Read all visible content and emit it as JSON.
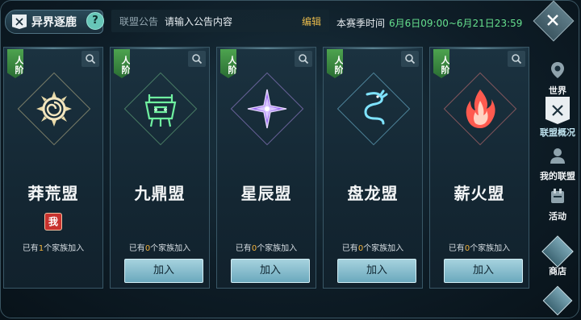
{
  "header": {
    "title": "异界逐鹿",
    "help_label": "?",
    "notice_label": "联盟公告",
    "notice_placeholder": "请输入公告内容",
    "edit_label": "编辑",
    "season_label": "本赛季时间",
    "season_time": "6月6日09:00~6月21日23:59"
  },
  "alliances": [
    {
      "rank": "人阶",
      "name": "莽荒盟",
      "count_prefix": "已有",
      "count": "1",
      "count_suffix": "个家族加入",
      "me": "我",
      "emblem": "sun-vortex-emblem",
      "color": "#e8d9a8"
    },
    {
      "rank": "人阶",
      "name": "九鼎盟",
      "count_prefix": "已有",
      "count": "0",
      "count_suffix": "个家族加入",
      "join": "加入",
      "emblem": "cauldron-emblem",
      "color": "#6ff0a0"
    },
    {
      "rank": "人阶",
      "name": "星辰盟",
      "count_prefix": "已有",
      "count": "0",
      "count_suffix": "个家族加入",
      "join": "加入",
      "emblem": "star-emblem",
      "color": "#b58cff"
    },
    {
      "rank": "人阶",
      "name": "盘龙盟",
      "count_prefix": "已有",
      "count": "0",
      "count_suffix": "个家族加入",
      "join": "加入",
      "emblem": "dragon-emblem",
      "color": "#7fe3ff"
    },
    {
      "rank": "人阶",
      "name": "薪火盟",
      "count_prefix": "已有",
      "count": "0",
      "count_suffix": "个家族加入",
      "join": "加入",
      "emblem": "flame-emblem",
      "color": "#ff6a6a"
    }
  ],
  "nav": [
    {
      "label": "世界",
      "icon": "map-pin-icon"
    },
    {
      "label": "联盟概况",
      "icon": "shield-icon"
    },
    {
      "label": "我的联盟",
      "icon": "person-icon"
    },
    {
      "label": "活动",
      "icon": "calendar-icon"
    },
    {
      "label": "商店",
      "icon": "shop-icon"
    }
  ]
}
